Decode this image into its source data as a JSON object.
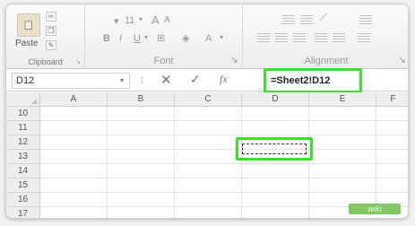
{
  "ribbon": {
    "clipboard": {
      "paste_label": "Paste",
      "group_label": "Clipboard"
    },
    "font": {
      "size_value": "11",
      "bold": "B",
      "italic": "I",
      "underline": "U",
      "grow": "A",
      "shrink": "A",
      "font_color": "A",
      "group_label": "Font"
    },
    "alignment": {
      "group_label": "Alignment"
    }
  },
  "formula_bar": {
    "name_box": "D12",
    "cancel_glyph": "✕",
    "enter_glyph": "✓",
    "fx": "fx",
    "formula": "=Sheet2!D12"
  },
  "grid": {
    "columns": [
      "A",
      "B",
      "C",
      "D",
      "E",
      "F"
    ],
    "rows": [
      "10",
      "11",
      "12",
      "13",
      "14",
      "15",
      "16",
      "17"
    ],
    "selected_cell": "D12"
  },
  "watermark": "wiki",
  "colors": {
    "highlight": "#3be02a"
  }
}
